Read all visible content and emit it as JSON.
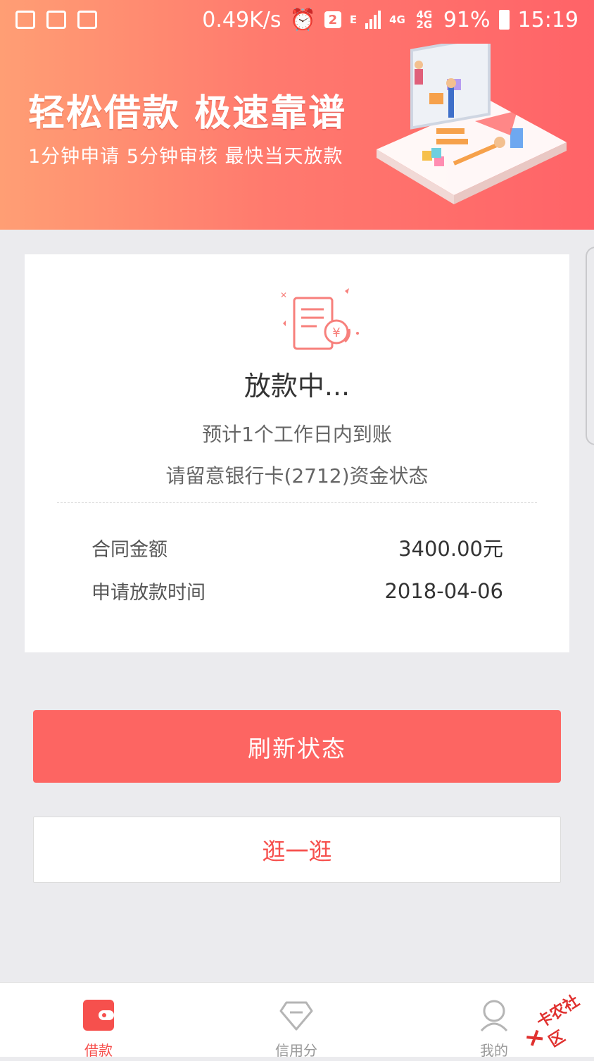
{
  "status_bar": {
    "net_speed": "0.49K/s",
    "badge": "2",
    "network_e": "E",
    "network_4g": "4G",
    "network_4g2g": "4G 2G",
    "battery": "91%",
    "time": "15:19"
  },
  "banner": {
    "title": "轻松借款 极速靠谱",
    "subtitle": "1分钟申请  5分钟审核  最快当天放款"
  },
  "status_card": {
    "title": "放款中...",
    "line1": "预计1个工作日内到账",
    "line2": "请留意银行卡(2712)资金状态",
    "rows": [
      {
        "label": "合同金额",
        "value": "3400.00元"
      },
      {
        "label": "申请放款时间",
        "value": "2018-04-06"
      }
    ]
  },
  "buttons": {
    "refresh": "刷新状态",
    "browse": "逛一逛"
  },
  "nav": {
    "items": [
      {
        "label": "借款",
        "icon": "wallet-icon",
        "active": true
      },
      {
        "label": "信用分",
        "icon": "diamond-icon",
        "active": false
      },
      {
        "label": "我的",
        "icon": "user-icon",
        "active": false
      }
    ]
  },
  "watermark": "卡农社区",
  "colors": {
    "accent": "#fd6562",
    "banner_start": "#ff9e74",
    "banner_end": "#ff6368",
    "background": "#ebebee"
  }
}
